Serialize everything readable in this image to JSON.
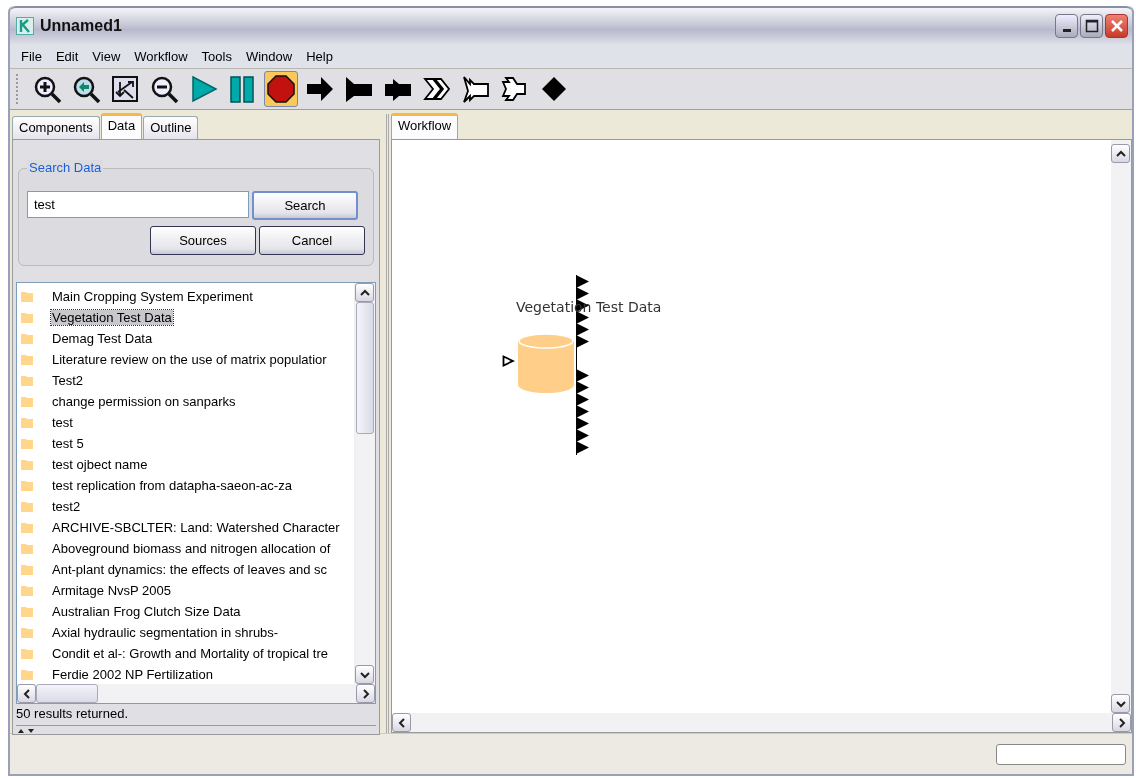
{
  "window": {
    "title": "Unnamed1"
  },
  "menu": [
    "File",
    "Edit",
    "View",
    "Workflow",
    "Tools",
    "Window",
    "Help"
  ],
  "toolbar": [
    {
      "kind": "zoom_in",
      "pressed": false
    },
    {
      "kind": "zoom_reset",
      "pressed": false
    },
    {
      "kind": "zoom_fit",
      "pressed": false
    },
    {
      "kind": "zoom_out",
      "pressed": false
    },
    {
      "kind": "run",
      "pressed": false
    },
    {
      "kind": "pause",
      "pressed": false
    },
    {
      "kind": "stop",
      "pressed": true
    },
    {
      "kind": "solid_arrow",
      "pressed": false
    },
    {
      "kind": "solid_notched",
      "pressed": false
    },
    {
      "kind": "solid_double",
      "pressed": false
    },
    {
      "kind": "hollow_arrow",
      "pressed": false
    },
    {
      "kind": "hollow_notched",
      "pressed": false
    },
    {
      "kind": "hollow_double",
      "pressed": false
    },
    {
      "kind": "diamond",
      "pressed": false
    }
  ],
  "left_tabs": [
    {
      "label": "Components",
      "selected": false
    },
    {
      "label": "Data",
      "selected": true
    },
    {
      "label": "Outline",
      "selected": false
    }
  ],
  "search": {
    "legend": "Search Data",
    "value": "test",
    "buttons": [
      "Search",
      "Sources",
      "Cancel"
    ]
  },
  "results": [
    {
      "label": "Main Cropping System Experiment",
      "selected": false
    },
    {
      "label": "Vegetation Test Data",
      "selected": true
    },
    {
      "label": "Demag Test Data",
      "selected": false
    },
    {
      "label": "Literature review on the use of matrix populatior",
      "selected": false
    },
    {
      "label": "Test2",
      "selected": false
    },
    {
      "label": "change permission on sanparks",
      "selected": false
    },
    {
      "label": "test",
      "selected": false
    },
    {
      "label": "test 5",
      "selected": false
    },
    {
      "label": "test ojbect name",
      "selected": false
    },
    {
      "label": "test replication from datapha-saeon-ac-za",
      "selected": false
    },
    {
      "label": "test2",
      "selected": false
    },
    {
      "label": "ARCHIVE-SBCLTER: Land: Watershed Character",
      "selected": false
    },
    {
      "label": "Aboveground biomass and nitrogen allocation of",
      "selected": false
    },
    {
      "label": "Ant-plant dynamics: the effects of leaves and sc",
      "selected": false
    },
    {
      "label": "Armitage NvsP 2005",
      "selected": false
    },
    {
      "label": "Australian Frog Clutch Size Data",
      "selected": false
    },
    {
      "label": "Axial hydraulic segmentation in shrubs-",
      "selected": false
    },
    {
      "label": "Condit et al-: Growth and Mortality of tropical tre",
      "selected": false
    },
    {
      "label": "Ferdie 2002 NP Fertilization",
      "selected": false
    }
  ],
  "results_status": "50 results returned.",
  "workflow_tabs": [
    {
      "label": "Workflow",
      "selected": true
    }
  ],
  "canvas": {
    "actors": [
      {
        "label": "Vegetation Test Data"
      }
    ]
  }
}
